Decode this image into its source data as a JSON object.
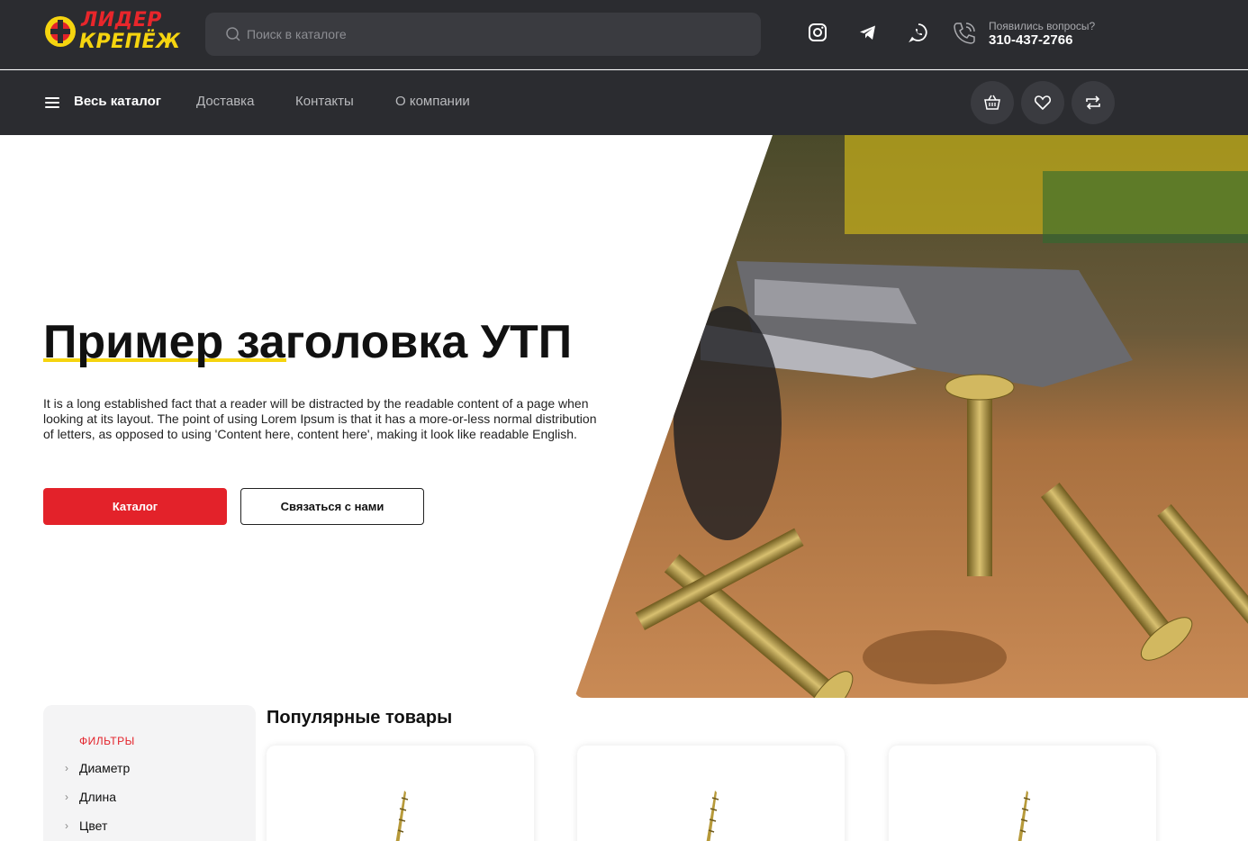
{
  "logo": {
    "line1": "ЛИДЕР",
    "line2": "КРЕПЁЖ"
  },
  "search": {
    "placeholder": "Поиск в каталоге"
  },
  "contacts": {
    "question": "Появились вопросы?",
    "phone": "310-437-2766"
  },
  "social": [
    "instagram-icon",
    "telegram-icon",
    "whatsapp-icon"
  ],
  "nav": {
    "catalog_label": "Весь каталог",
    "links": [
      "Доставка",
      "Контакты",
      "О компании"
    ],
    "actions": [
      "basket-icon",
      "heart-icon",
      "compare-icon"
    ]
  },
  "hero": {
    "title": "Пример заголовка УТП",
    "text": "It is a long established fact that a reader will be distracted by the readable content of a page when looking at its layout. The point of using Lorem Ipsum is that it has a more-or-less normal distribution of letters, as opposed to using 'Content here, content here', making it look like readable English.",
    "btn_catalog": "Каталог",
    "btn_contact": "Связаться с нами"
  },
  "filters": {
    "title": "ФИЛЬТРЫ",
    "items": [
      "Диаметр",
      "Длина",
      "Цвет"
    ]
  },
  "popular": {
    "title": "Популярные товары"
  },
  "colors": {
    "accent": "#e3222a",
    "yellow": "#f5d40f",
    "header_bg": "#2b2c30"
  }
}
